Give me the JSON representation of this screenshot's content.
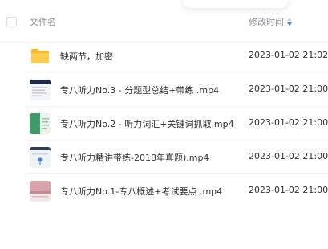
{
  "header": {
    "name_label": "文件名",
    "time_label": "修改时间",
    "sort_icon": "sort-desc-icon"
  },
  "files": [
    {
      "name": "缺两节，加密",
      "time": "2023-01-02 21:02",
      "type": "folder",
      "icon": "folder-icon",
      "accent": "#f7c23a"
    },
    {
      "name": "专八听力No.3 - 分题型总结+带练 .mp4",
      "time": "2023-01-02 21:00",
      "type": "video",
      "icon": "video-thumbnail",
      "accent": "#1b2a47"
    },
    {
      "name": "专八听力No.2 - 听力词汇+关键词抓取.mp4",
      "time": "2023-01-02 21:00",
      "type": "video",
      "icon": "video-thumbnail",
      "accent": "#3f9a6a"
    },
    {
      "name": "专八听力精讲带练-2018年真题).mp4",
      "time": "2023-01-02 21:00",
      "type": "video",
      "icon": "video-thumbnail",
      "accent": "#3b7fd6"
    },
    {
      "name": "专八听力No.1-专八概述+考试要点 .mp4",
      "time": "2023-01-02 21:00",
      "type": "video",
      "icon": "video-thumbnail",
      "accent": "#c98a94"
    }
  ]
}
